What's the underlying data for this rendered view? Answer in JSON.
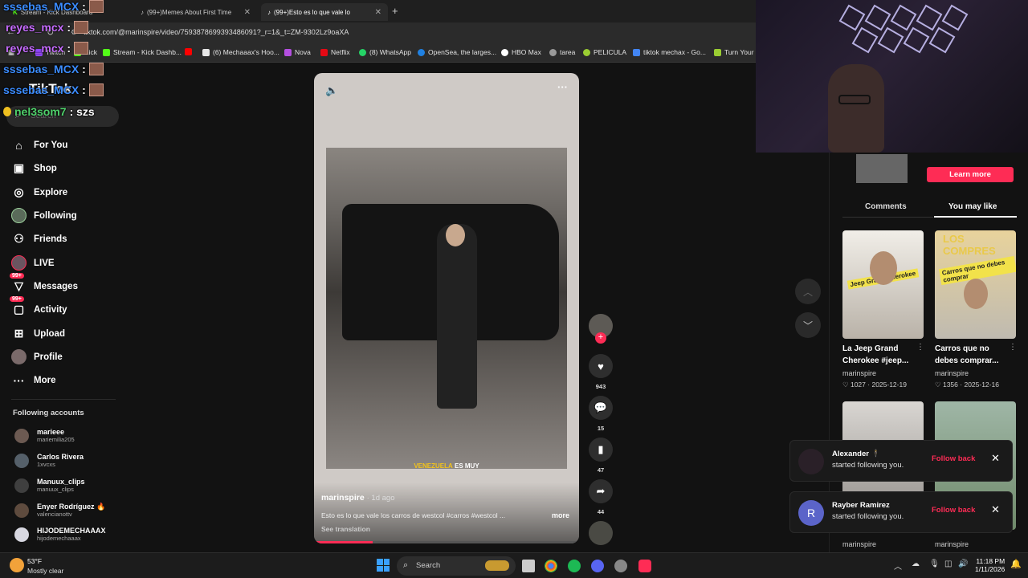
{
  "browser": {
    "tabs": [
      {
        "label": "Stream - Kick Dashboard",
        "close": "✕"
      },
      {
        "label": "(99+)Memes About First Time",
        "close": "✕"
      },
      {
        "label": "(99+)Esto es lo que vale lo",
        "close": "✕"
      }
    ],
    "new_tab": "+",
    "url": "tiktok.com/@marinspire/video/7593878699393486091?_r=1&_t=ZM-9302Lz9oaXA",
    "bookmarks": [
      {
        "label": "Twitch",
        "color": "#9146ff"
      },
      {
        "label": "Kick",
        "color": "#53fc18"
      },
      {
        "label": "Stream - Kick Dashb...",
        "color": "#53fc18"
      },
      {
        "label": "",
        "color": "#ff0000"
      },
      {
        "label": "(6) Mechaaax's Hoo...",
        "color": "#e7e7e7"
      },
      {
        "label": "Nova",
        "color": "#b44fe0"
      },
      {
        "label": "Netflix",
        "color": "#e50914"
      },
      {
        "label": "(8) WhatsApp",
        "color": "#25d366"
      },
      {
        "label": "OpenSea, the larges...",
        "color": "#2081e2"
      },
      {
        "label": "HBO Max",
        "color": "#ffffff"
      },
      {
        "label": "tarea",
        "color": "#999999"
      },
      {
        "label": "PELICULA",
        "color": "#9acd32"
      },
      {
        "label": "tiktok mechax - Go...",
        "color": "#4285f4"
      },
      {
        "label": "Turn Your S",
        "color": "#9acd32"
      }
    ]
  },
  "chat_overlay": [
    {
      "user": "sssebas_MCX",
      "sep": ":",
      "color": "#3b8cff"
    },
    {
      "user": "reyes_mcx",
      "sep": ":",
      "color": "#c66cff"
    },
    {
      "user": "reyes_mcx",
      "sep": ":",
      "color": "#c66cff"
    },
    {
      "user": "sssebas_MCX",
      "sep": ":",
      "color": "#3b8cff"
    },
    {
      "user": "sssebas_MCX",
      "sep": ":",
      "color": "#3b8cff"
    },
    {
      "user": "nel3som7",
      "sep": ": szs",
      "color": "#4fd16b"
    }
  ],
  "tiktok": {
    "logo": "TikTok",
    "search_placeholder": "Search",
    "nav": [
      {
        "label": "For You",
        "icon": "home-icon",
        "glyph": "⌂"
      },
      {
        "label": "Shop",
        "icon": "shop-icon",
        "glyph": "🛍"
      },
      {
        "label": "Explore",
        "icon": "explore-icon",
        "glyph": "◎"
      },
      {
        "label": "Following",
        "icon": "following-avatar-icon",
        "glyph": "●"
      },
      {
        "label": "Friends",
        "icon": "friends-icon",
        "glyph": "👥"
      },
      {
        "label": "LIVE",
        "icon": "live-icon",
        "glyph": "●"
      },
      {
        "label": "Messages",
        "icon": "messages-icon",
        "glyph": "✉",
        "badge": "99+"
      },
      {
        "label": "Activity",
        "icon": "activity-icon",
        "glyph": "♡",
        "badge": "99+"
      },
      {
        "label": "Upload",
        "icon": "upload-icon",
        "glyph": "⊞"
      },
      {
        "label": "Profile",
        "icon": "profile-icon",
        "glyph": "●"
      },
      {
        "label": "More",
        "icon": "more-icon",
        "glyph": "···"
      }
    ],
    "following_title": "Following accounts",
    "following": [
      {
        "name": "marieee",
        "handle": "mariemilia205"
      },
      {
        "name": "Carlos Rivera",
        "handle": "1xvcxs"
      },
      {
        "name": "Manuux_clips",
        "handle": "manuux_clips"
      },
      {
        "name": "Enyer Rodríguez 🔥",
        "handle": "valencianottv"
      },
      {
        "name": "HIJODEMECHAAAX",
        "handle": "hijodemechaaax"
      }
    ]
  },
  "video": {
    "author": "marinspire",
    "age": "· 1d ago",
    "description": "Esto es lo que vale los carros de westcol #carros #westcol ...",
    "more": "more",
    "translation": "See translation",
    "overlay_text_highlight": "VENEZUELA",
    "overlay_text_rest": "ES MUY",
    "progress": 0.22,
    "likes": "943",
    "comments": "15",
    "saves": "47",
    "shares": "44"
  },
  "right_panel": {
    "learn_more": "Learn more",
    "tabs": [
      "Comments",
      "You may like"
    ],
    "cards": [
      {
        "title": "La Jeep Grand Cherokee #jeep...",
        "author": "marinspire",
        "likes": "♡ 1027",
        "date": "2025-12-19",
        "thumb_label": "Jeep Grand Cherokee"
      },
      {
        "title": "Carros que no debes comprar...",
        "author": "marinspire",
        "likes": "♡ 1356",
        "date": "2025-12-16",
        "thumb_label": "Carros que no debes comprar",
        "thumb_top": "LOS COMPRES"
      }
    ],
    "cards_row2_authors": [
      "marinspire",
      "marinspire"
    ]
  },
  "notifications": [
    {
      "name": "Alexander 🕴",
      "message": "started following you.",
      "action": "Follow back",
      "avatar": ""
    },
    {
      "name": "Rayber Ramirez",
      "message": "started following you.",
      "action": "Follow back",
      "avatar": "R"
    }
  ],
  "taskbar": {
    "weather_temp": "53°F",
    "weather_desc": "Mostly clear",
    "search": "Search",
    "time": "11:18 PM",
    "date": "1/11/2026"
  }
}
